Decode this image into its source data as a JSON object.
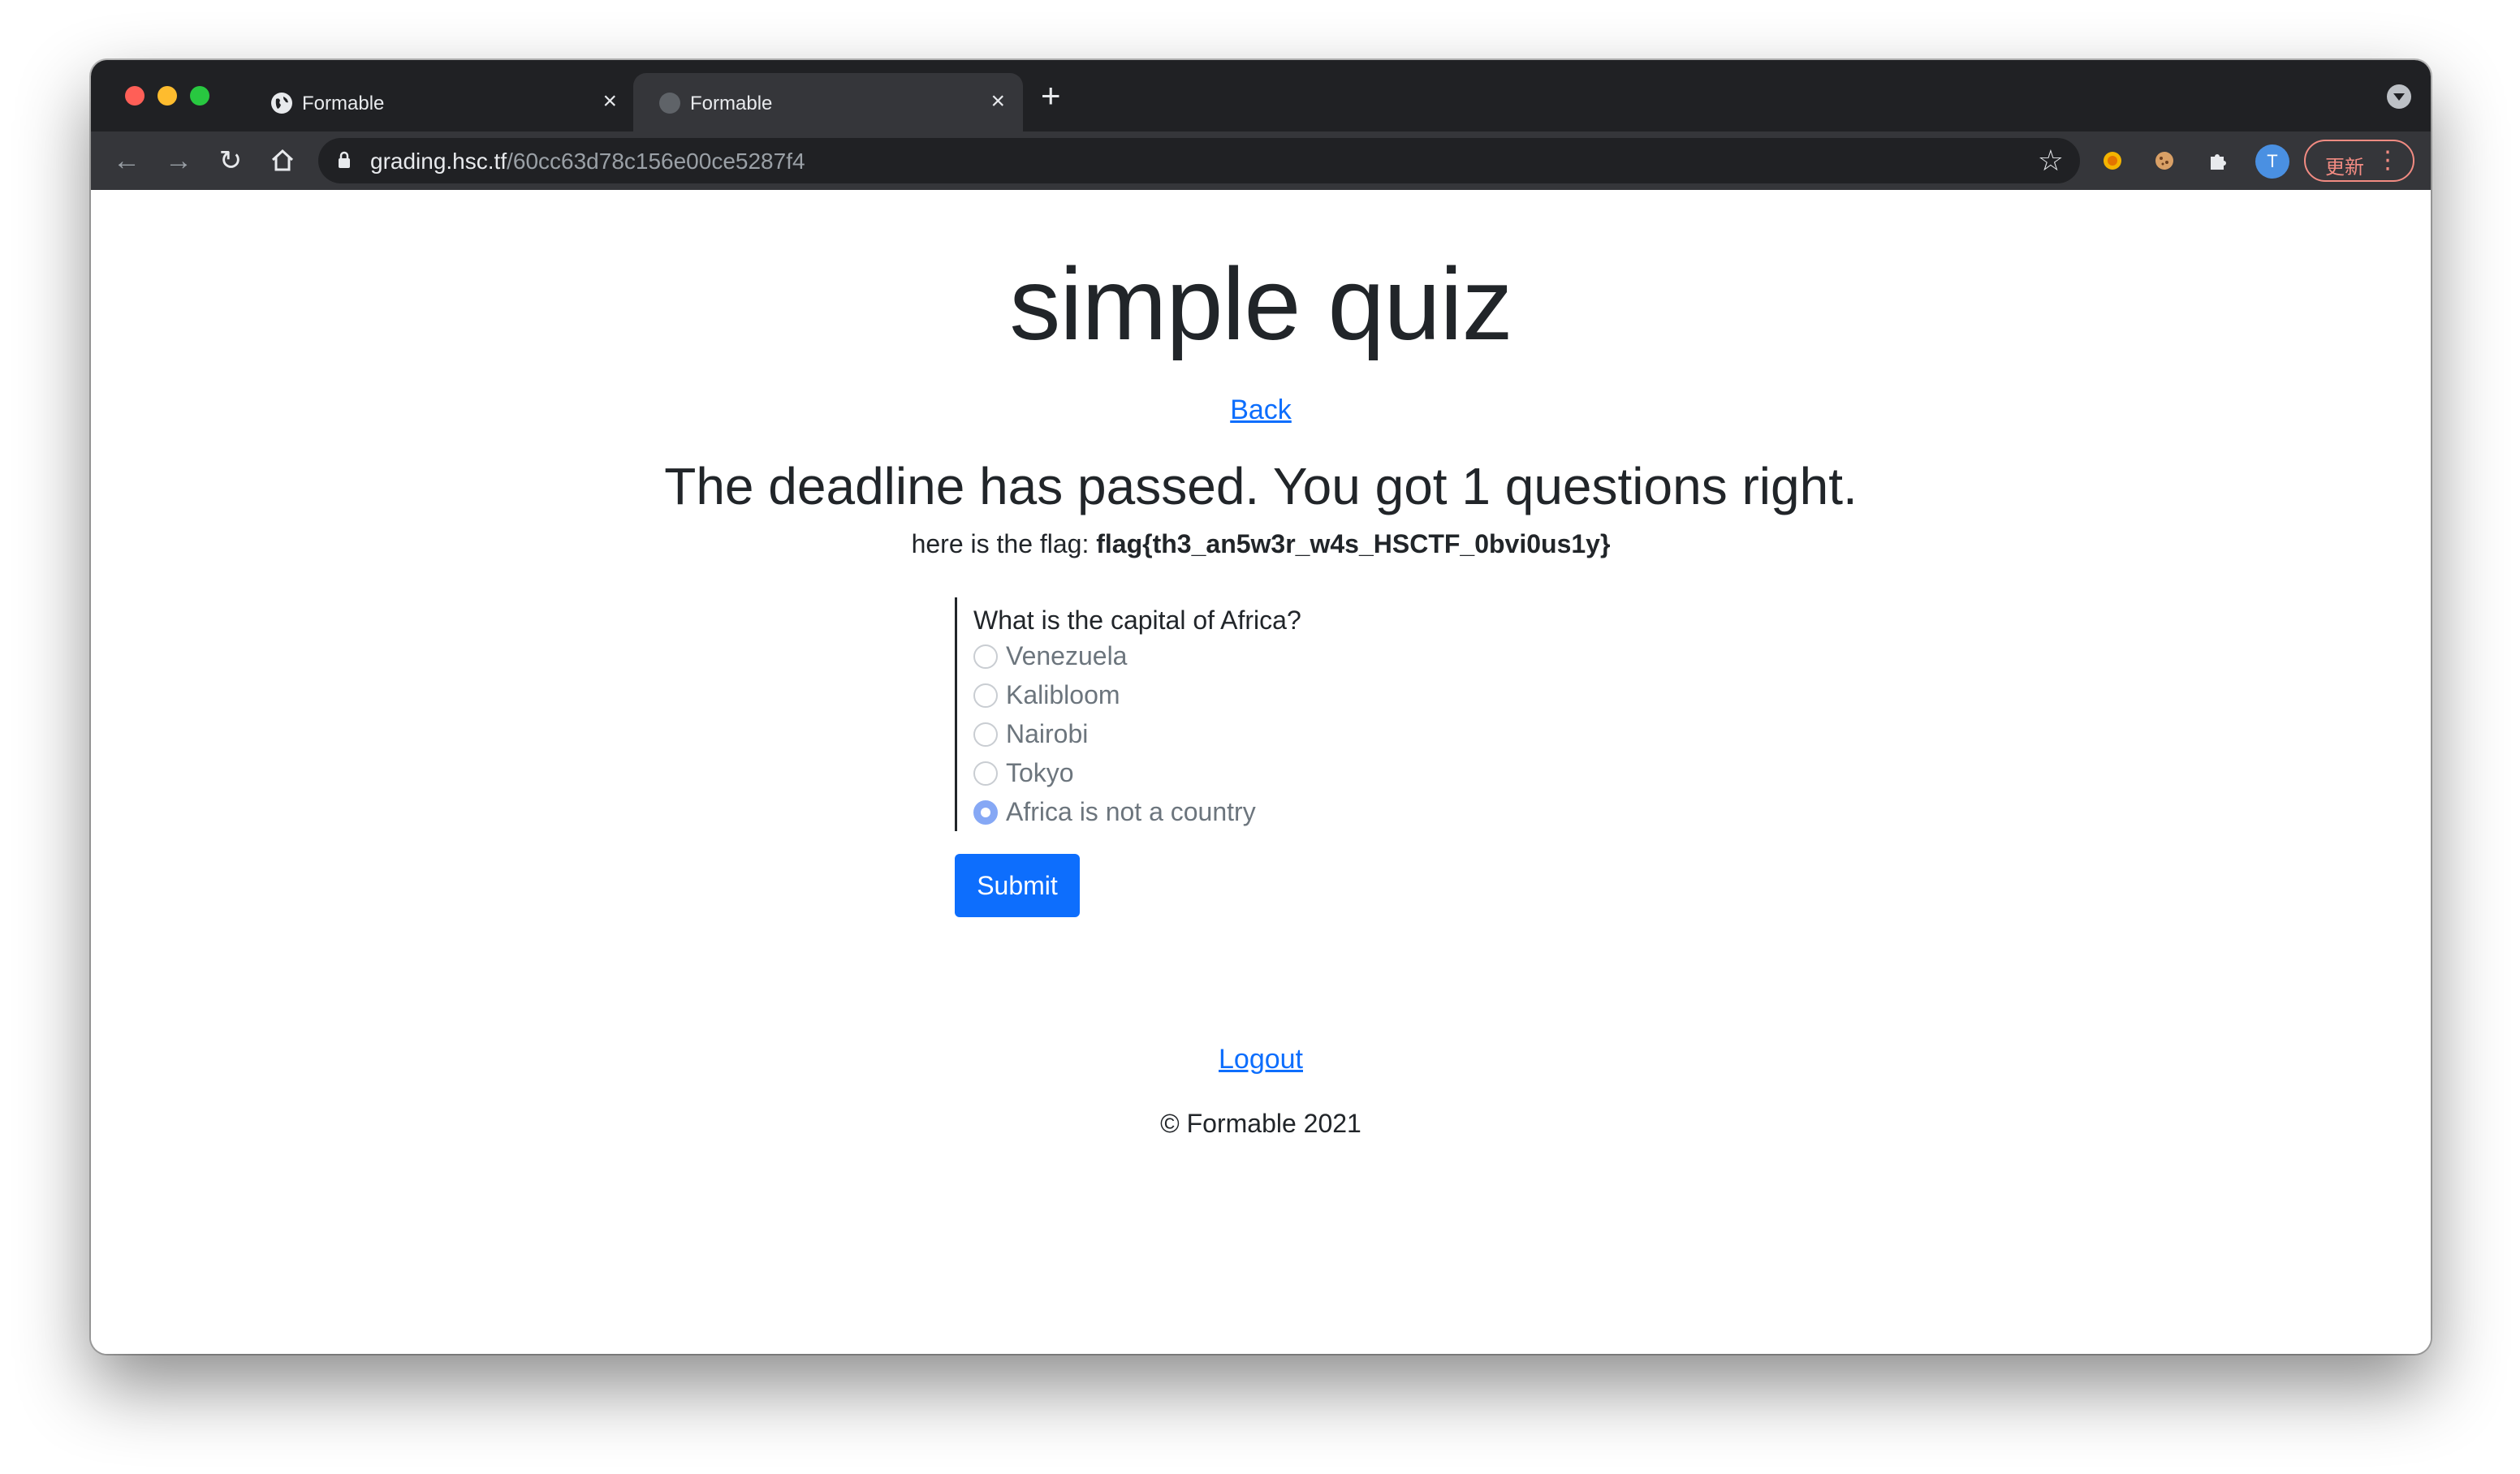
{
  "browser": {
    "tabs": [
      {
        "title": "Formable",
        "active": false
      },
      {
        "title": "Formable",
        "active": true
      }
    ],
    "new_tab_glyph": "+",
    "close_glyph": "×",
    "url_host": "grading.hsc.tf",
    "url_path": "/60cc63d78c156e00ce5287f4",
    "avatar_initial": "T",
    "update_label": "更新",
    "nav_icons": [
      "back-arrow-icon",
      "forward-arrow-icon",
      "reload-icon",
      "home-icon"
    ],
    "extension_icons": [
      "coin-extension-icon",
      "cookie-extension-icon",
      "puzzle-extensions-icon"
    ]
  },
  "page": {
    "title": "simple quiz",
    "back_link": "Back",
    "result_heading": "The deadline has passed. You got 1 questions right.",
    "flag_prefix": "here is the flag: ",
    "flag_value": "flag{th3_an5w3r_w4s_HSCTF_0bvi0us1y}",
    "question": "What is the capital of Africa?",
    "options": [
      {
        "label": "Venezuela",
        "selected": false
      },
      {
        "label": "Kalibloom",
        "selected": false
      },
      {
        "label": "Nairobi",
        "selected": false
      },
      {
        "label": "Tokyo",
        "selected": false
      },
      {
        "label": "Africa is not a country",
        "selected": true
      }
    ],
    "submit_label": "Submit",
    "logout_link": "Logout",
    "footer": "© Formable 2021"
  },
  "colors": {
    "link": "#0d6efd",
    "button": "#0d6efd",
    "text": "#212529",
    "muted": "#6c757d",
    "browser_frame": "#202124",
    "toolbar": "#35363a"
  }
}
